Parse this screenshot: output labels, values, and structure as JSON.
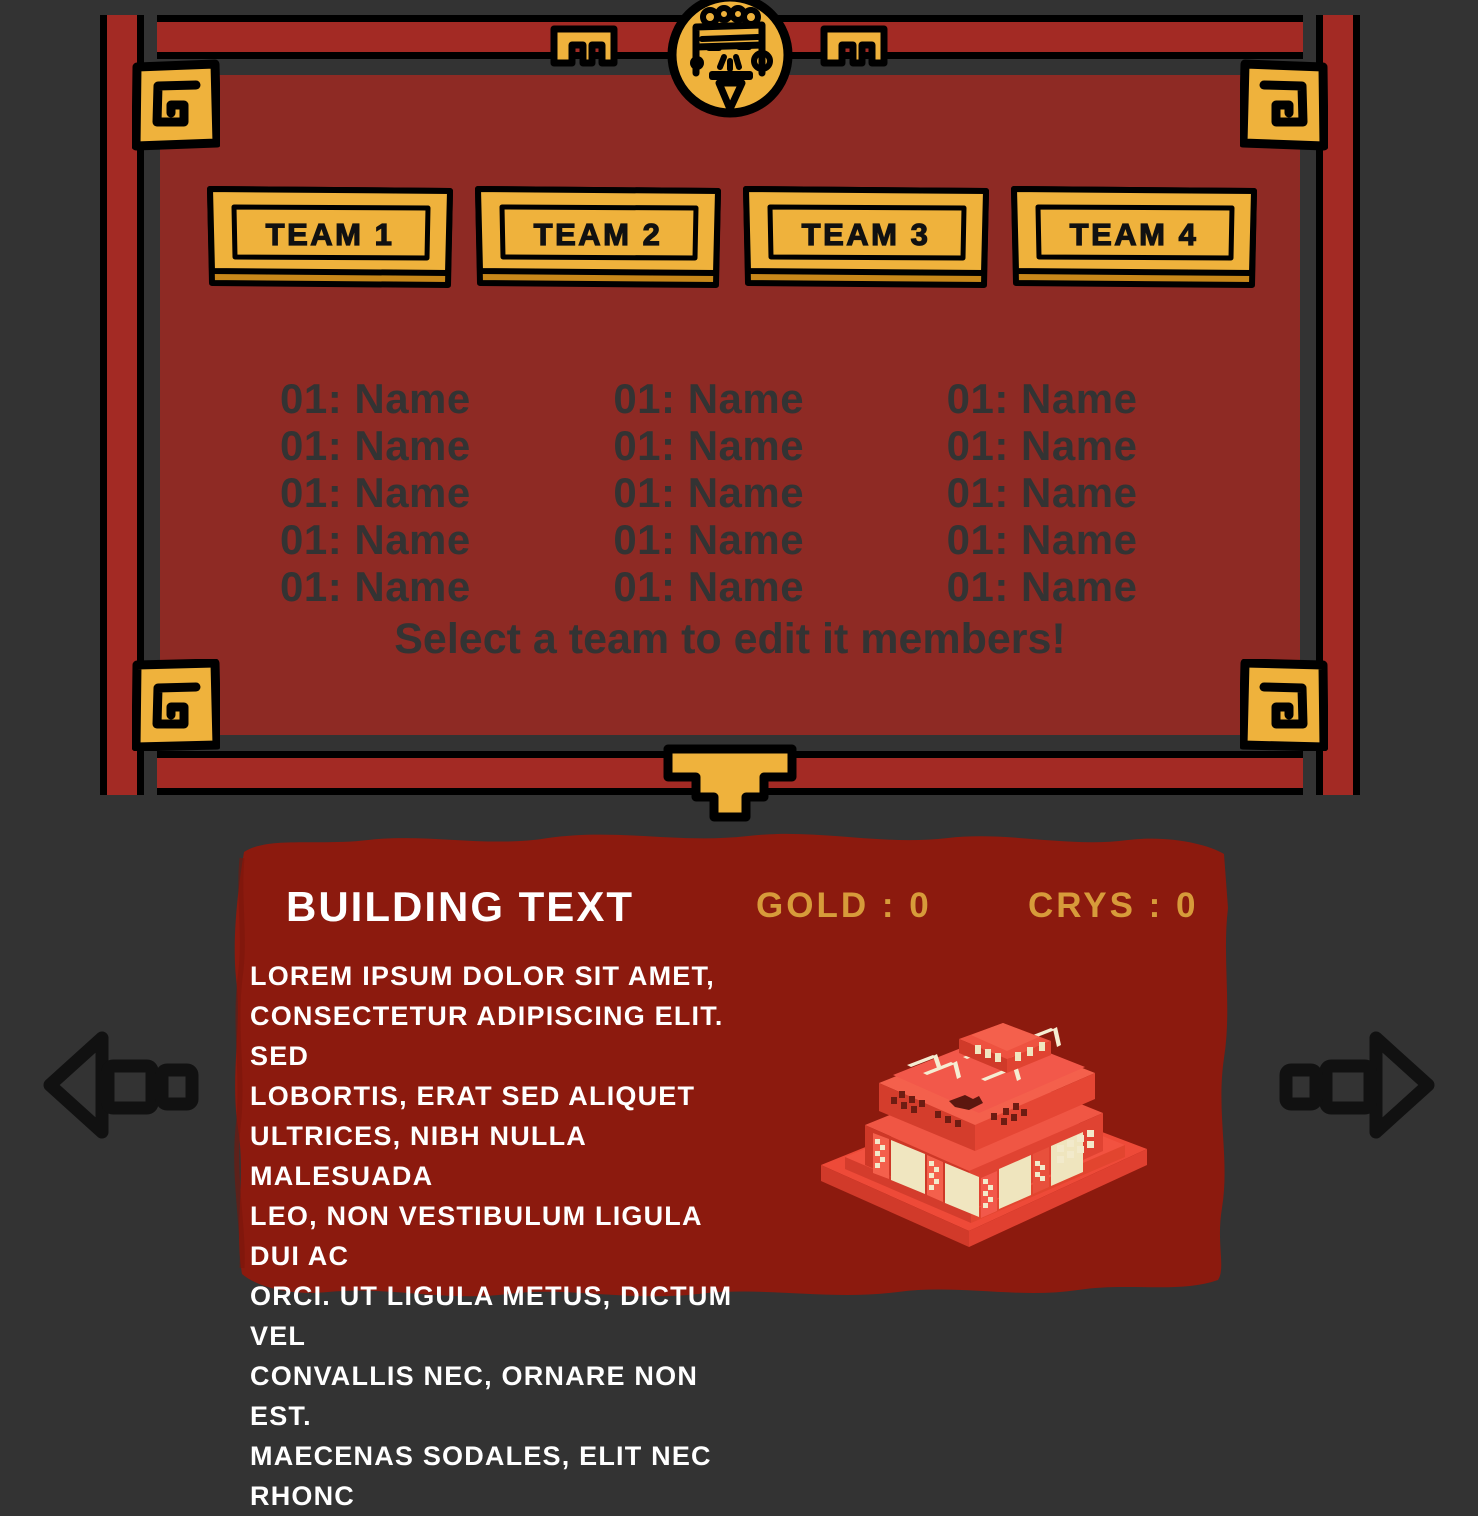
{
  "theme": {
    "background": "#333333",
    "panel_red": "#8E2A24",
    "frame_red": "#A32A24",
    "gold": "#EFB23C",
    "gold_dark": "#C8881A",
    "outline": "#000000",
    "text_dark": "#333333",
    "white": "#FFFFFF",
    "resource_gold": "#D79B3A",
    "building_panel_red": "#8C1A0E",
    "building_red": "#E8382A"
  },
  "emblem": {
    "icon": "aztec-face-emblem"
  },
  "team_panel": {
    "tabs": [
      {
        "label": "TEAM 1",
        "name": "team-1"
      },
      {
        "label": "TEAM 2",
        "name": "team-2"
      },
      {
        "label": "TEAM 3",
        "name": "team-3"
      },
      {
        "label": "TEAM 4",
        "name": "team-4"
      }
    ],
    "members": [
      "01: Name",
      "01: Name",
      "01: Name",
      "01: Name",
      "01: Name",
      "01: Name",
      "01: Name",
      "01: Name",
      "01: Name",
      "01: Name",
      "01: Name",
      "01: Name",
      "01: Name",
      "01: Name",
      "01: Name"
    ],
    "hint": "Select a team to edit it members!"
  },
  "building_panel": {
    "title": "BUILDING TEXT",
    "gold_label": "GOLD : 0",
    "crys_label": "CRYS : 0",
    "description": "LOREM IPSUM DOLOR SIT AMET,\nCONSECTETUR ADIPISCING ELIT. SED\nLOBORTIS, ERAT SED ALIQUET\nULTRICES, NIBH NULLA MALESUADA\nLEO, NON VESTIBULUM LIGULA DUI AC\nORCI. UT LIGULA METUS, DICTUM VEL\nCONVALLIS NEC, ORNARE NON EST.\nMAECENAS SODALES, ELIT NEC RHONC",
    "art": {
      "icon": "aztec-temple-building"
    }
  },
  "navigation": {
    "prev": {
      "icon": "arrow-left-icon"
    },
    "next": {
      "icon": "arrow-right-icon"
    }
  }
}
